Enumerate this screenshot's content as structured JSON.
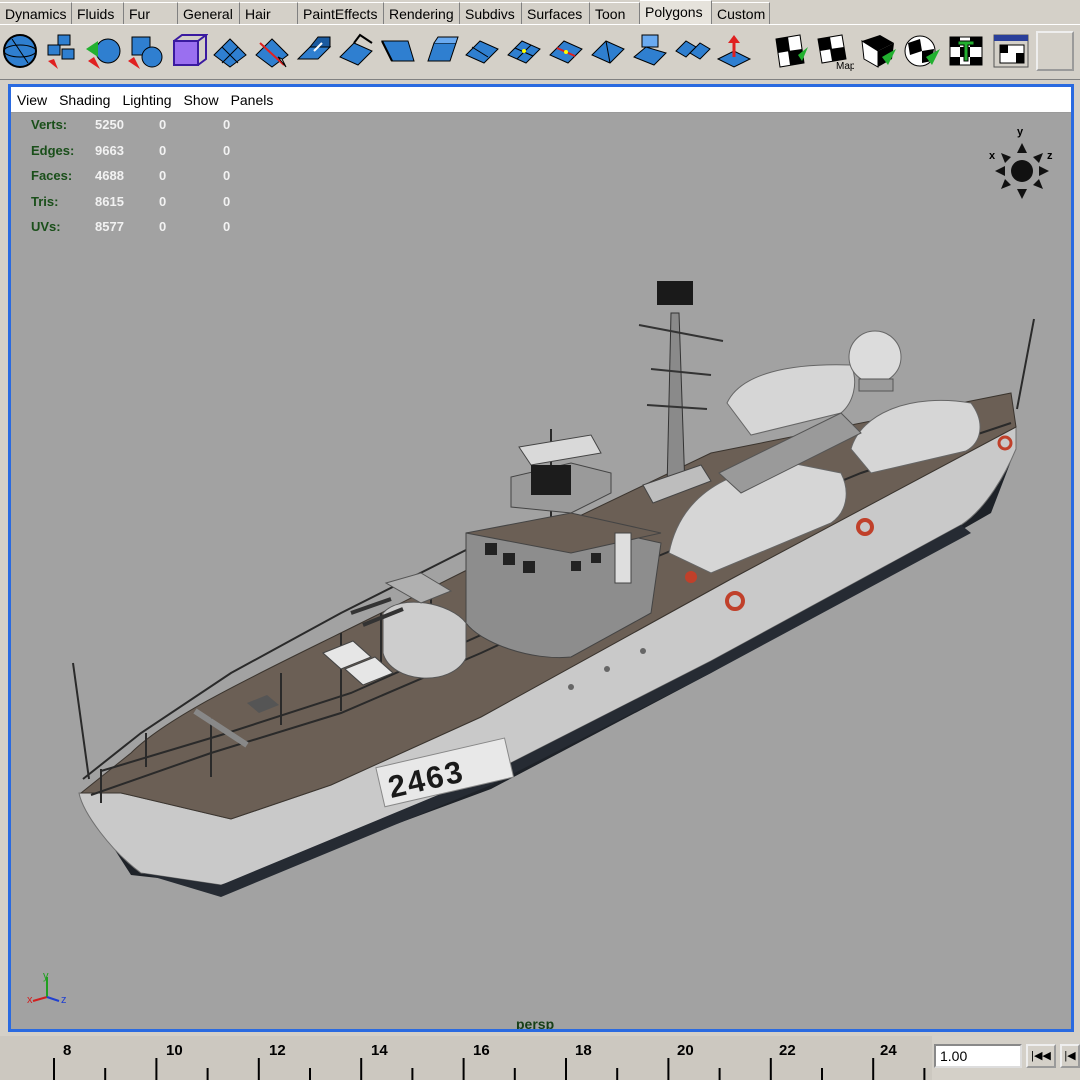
{
  "shelf_tabs": [
    "Dynamics",
    "Fluids",
    "Fur",
    "General",
    "Hair",
    "PaintEffects",
    "Rendering",
    "Subdivs",
    "Surfaces",
    "Toon",
    "Polygons",
    "Custom"
  ],
  "active_tab": "Polygons",
  "shelf_tools": [
    "poly-sphere-icon",
    "poly-cube-icon",
    "poly-cylinder-icon",
    "poly-cone-icon",
    "poly-wire-cube-icon",
    "poly-plane-icon",
    "poly-split-icon",
    "poly-extrude-face-icon",
    "poly-extrude-edge-icon",
    "poly-bridge-icon",
    "poly-bevel-icon",
    "poly-append-icon",
    "poly-subdivide-icon",
    "poly-merge-icon",
    "poly-wedge-icon",
    "poly-poke-icon",
    "poly-combine-icon",
    "poly-normal-icon",
    "planar-map-icon",
    "cylindrical-map-icon",
    "spherical-map-icon",
    "automatic-map-icon",
    "texture-editor-icon",
    "uv-layout-icon",
    "uv-snapshot-icon"
  ],
  "viewport_menu": [
    "View",
    "Shading",
    "Lighting",
    "Show",
    "Panels"
  ],
  "hud": [
    {
      "label": "Verts:",
      "v1": "5250",
      "v2": "0",
      "v3": "0"
    },
    {
      "label": "Edges:",
      "v1": "9663",
      "v2": "0",
      "v3": "0"
    },
    {
      "label": "Faces:",
      "v1": "4688",
      "v2": "0",
      "v3": "0"
    },
    {
      "label": "Tris:",
      "v1": "8615",
      "v2": "0",
      "v3": "0"
    },
    {
      "label": "UVs:",
      "v1": "8577",
      "v2": "0",
      "v3": "0"
    }
  ],
  "view_cube_axes": {
    "x": "x",
    "y": "y",
    "z": "z"
  },
  "hull_number": "2463",
  "camera_label": "persp",
  "timeline_ticks": [
    "8",
    "10",
    "12",
    "14",
    "16",
    "18",
    "20",
    "22",
    "24"
  ],
  "current_time": "1.00",
  "colors": {
    "panel_border": "#2a6ae0",
    "viewport_bg": "#a2a2a2",
    "hud_label": "#1a4f1a",
    "shelf_blue": "#2f7fd0"
  }
}
